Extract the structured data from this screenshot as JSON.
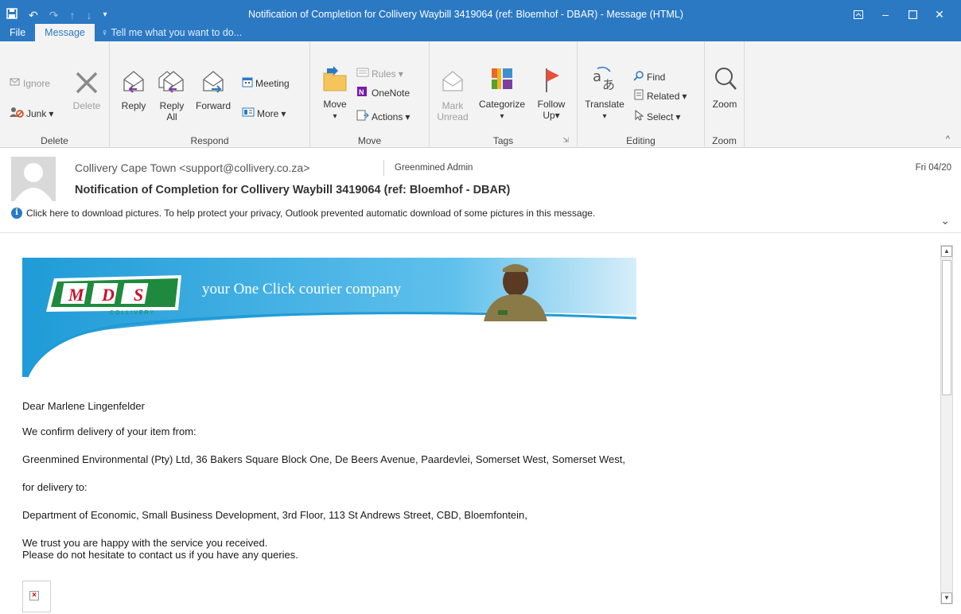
{
  "window": {
    "title": "Notification of Completion for Collivery Waybill 3419064 (ref: Bloemhof - DBAR) - Message (HTML)",
    "qat_icons": [
      "save-icon",
      "undo-icon",
      "redo-icon",
      "up-arrow-icon",
      "down-arrow-icon",
      "customize-qat-icon"
    ],
    "controls": [
      "ribbon-display-icon",
      "minimize-icon",
      "maximize-icon",
      "close-icon"
    ]
  },
  "tabs": {
    "file": "File",
    "message": "Message",
    "tellme": "Tell me what you want to do..."
  },
  "ribbon": {
    "delete": {
      "label": "Delete",
      "ignore": "Ignore",
      "junk": "Junk",
      "delete": "Delete"
    },
    "respond": {
      "label": "Respond",
      "reply": "Reply",
      "reply_all_1": "Reply",
      "reply_all_2": "All",
      "forward": "Forward",
      "meeting": "Meeting",
      "more": "More"
    },
    "move": {
      "label": "Move",
      "move": "Move",
      "rules": "Rules",
      "onenote": "OneNote",
      "actions": "Actions"
    },
    "tags": {
      "label": "Tags",
      "mark_1": "Mark",
      "mark_2": "Unread",
      "categorize": "Categorize",
      "follow_1": "Follow",
      "follow_2": "Up"
    },
    "editing": {
      "label": "Editing",
      "translate": "Translate",
      "find": "Find",
      "related": "Related",
      "select": "Select"
    },
    "zoom": {
      "label": "Zoom",
      "zoom": "Zoom"
    }
  },
  "header": {
    "from": "Collivery Cape Town <support@collivery.co.za>",
    "to": "Greenmined Admin",
    "date": "Fri 04/20",
    "subject": "Notification of Completion for Collivery Waybill 3419064 (ref: Bloemhof - DBAR)",
    "info": "Click here to download pictures. To help protect your privacy, Outlook prevented automatic download of some pictures in this message."
  },
  "banner": {
    "logo_letters": [
      "M",
      "D",
      "S"
    ],
    "logo_sub": "COLLIVERY",
    "tagline": "your One Click courier company"
  },
  "body": {
    "greeting": "Dear Marlene Lingenfelder",
    "confirm": "We confirm delivery of your item from:",
    "from_address": "Greenmined Environmental (Pty) Ltd, 36 Bakers Square Block One, De Beers Avenue, Paardevlei, Somerset West, Somerset West,",
    "for_delivery": "for delivery to:",
    "to_address": "Department of Economic, Small Business Development, 3rd Floor, 113 St Andrews Street, CBD, Bloemfontein,",
    "trust_1": "We trust you are happy with the service you received.",
    "trust_2": "Please do not hesitate to contact us if you have any queries."
  }
}
